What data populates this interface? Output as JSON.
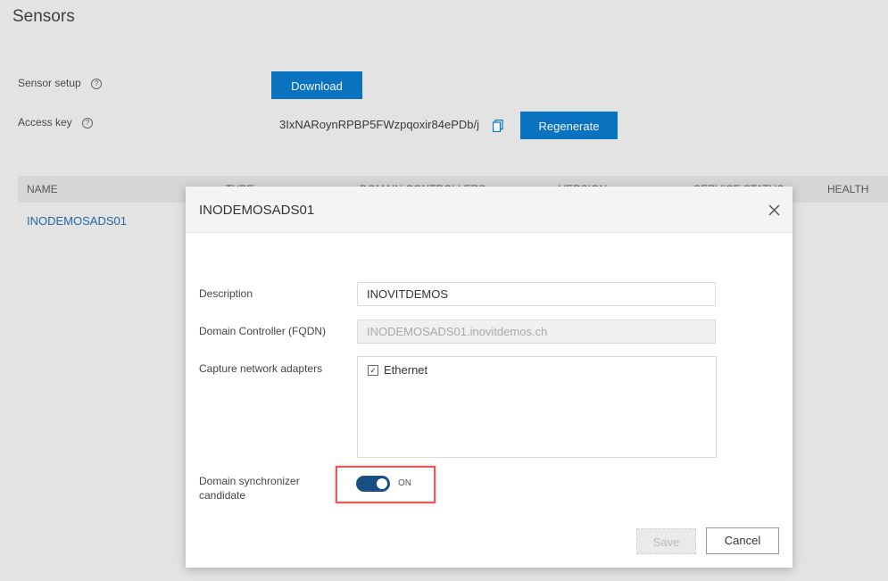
{
  "page": {
    "title": "Sensors",
    "sensor_setup_label": "Sensor setup",
    "access_key_label": "Access key",
    "help_glyph": "?",
    "download_label": "Download",
    "access_key_value": "3IxNARoynRPBP5FWzpqoxir84ePDb/j",
    "regenerate_label": "Regenerate"
  },
  "table": {
    "headers": [
      "NAME",
      "TYPE",
      "DOMAIN CONTROLLERS",
      "VERSION",
      "SERVICE STATUS",
      "HEALTH"
    ],
    "rows": [
      {
        "name": "INODEMOSADS01"
      }
    ]
  },
  "modal": {
    "title": "INODEMOSADS01",
    "description_label": "Description",
    "description_value": "INOVITDEMOS",
    "dc_label": "Domain Controller (FQDN)",
    "dc_value": "INODEMOSADS01.inovitdemos.ch",
    "adapters_label": "Capture network adapters",
    "adapters": [
      {
        "name": "Ethernet",
        "checked": true
      }
    ],
    "sync_label_line1": "Domain synchronizer",
    "sync_label_line2": "candidate",
    "toggle_state": "ON",
    "save_label": "Save",
    "cancel_label": "Cancel"
  },
  "colors": {
    "primary": "#0072c6",
    "toggle_on": "#1a4f85",
    "link": "#1a66a8",
    "highlight": "#e05c5c"
  }
}
